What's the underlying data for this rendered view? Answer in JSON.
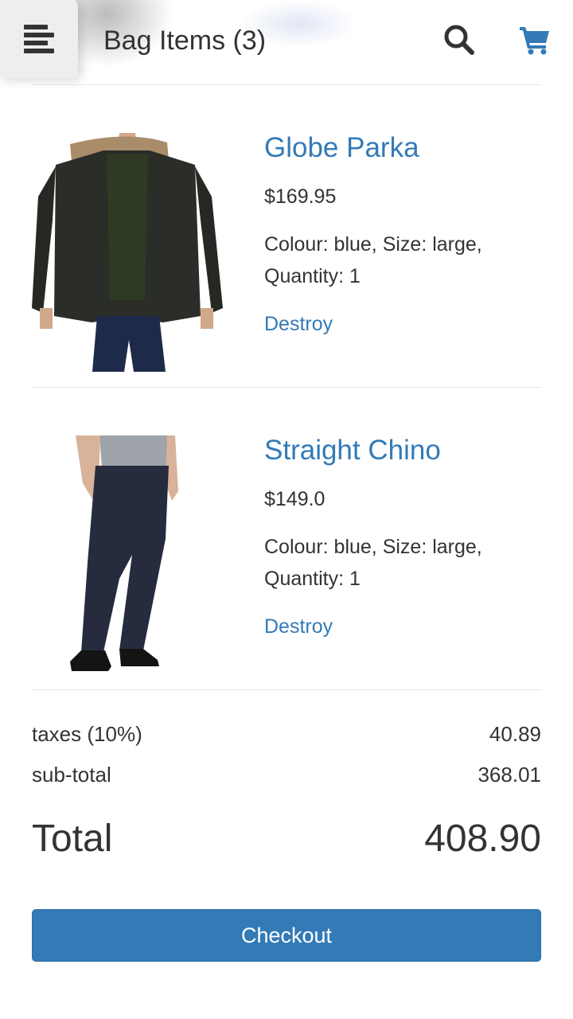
{
  "header": {
    "title": "Bag Items (3)",
    "menu_icon": "menu-icon",
    "search_icon": "search-icon",
    "cart_icon": "cart-icon",
    "accent_color": "#337ab7"
  },
  "items": [
    {
      "name": "Globe Parka",
      "price": "$169.95",
      "attributes": "Colour: blue, Size: large, Quantity: 1",
      "destroy_label": "Destroy",
      "image": "parka-photo"
    },
    {
      "name": "Straight Chino",
      "price": "$149.0",
      "attributes": "Colour: blue, Size: large, Quantity: 1",
      "destroy_label": "Destroy",
      "image": "chino-photo"
    }
  ],
  "summary": {
    "taxes_label": "taxes (10%)",
    "taxes_value": "40.89",
    "subtotal_label": "sub-total",
    "subtotal_value": "368.01",
    "total_label": "Total",
    "total_value": "408.90"
  },
  "checkout_label": "Checkout"
}
